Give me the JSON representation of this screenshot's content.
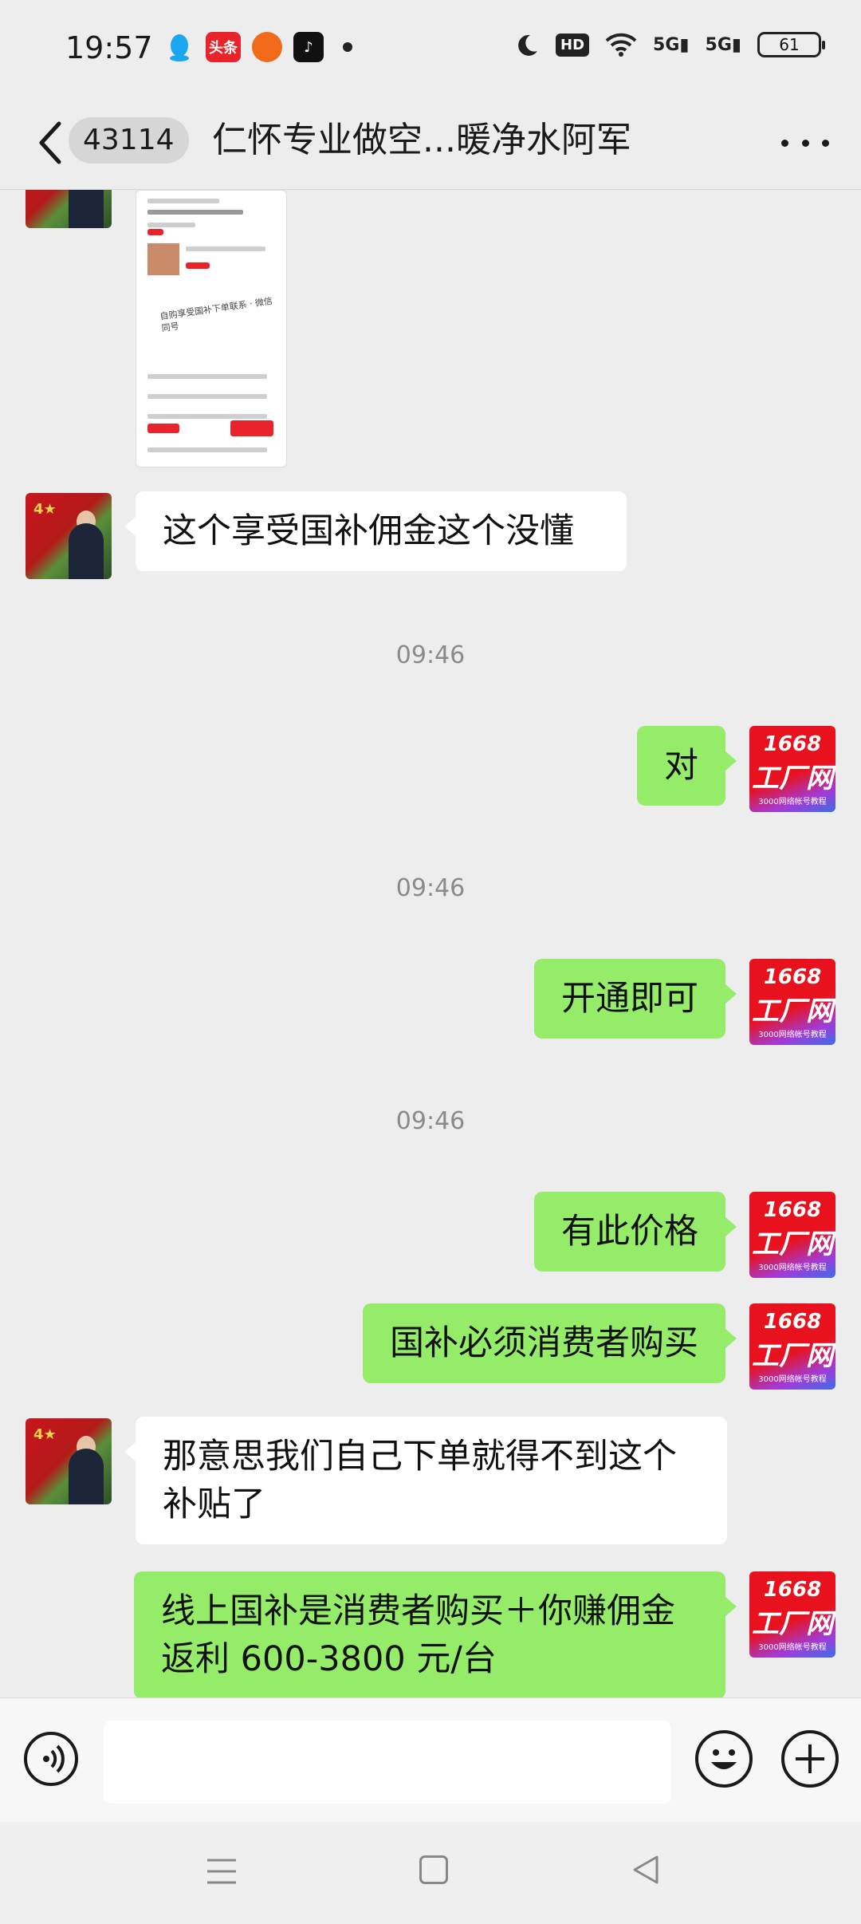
{
  "status_bar": {
    "time": "19:57",
    "app_icons": [
      "qq-icon",
      "toutiao-icon",
      "shop-icon",
      "tiktok-icon"
    ],
    "toutiao_label": "头条",
    "hd_label": "HD",
    "signal1": "5G",
    "signal2": "5G",
    "battery": "61"
  },
  "header": {
    "unread_count": "43114",
    "title": "仁怀专业做空...暖净水阿军"
  },
  "messages": [
    {
      "side": "in",
      "type": "image"
    },
    {
      "side": "in",
      "type": "text",
      "text": "这个享受国补佣金这个没懂"
    },
    {
      "type": "time",
      "text": "09:46"
    },
    {
      "side": "out",
      "type": "text",
      "text": "对"
    },
    {
      "type": "time",
      "text": "09:46"
    },
    {
      "side": "out",
      "type": "text",
      "text": "开通即可"
    },
    {
      "type": "time",
      "text": "09:46"
    },
    {
      "side": "out",
      "type": "text",
      "text": "有此价格"
    },
    {
      "side": "out",
      "type": "text",
      "text": "国补必须消费者购买"
    },
    {
      "side": "in",
      "type": "text",
      "text": "那意思我们自己下单就得不到这个补贴了"
    },
    {
      "side": "out",
      "type": "text",
      "text": "线上国补是消费者购买＋你赚佣金返利 600-3800 元/台"
    }
  ],
  "avatar_right": {
    "line1": "1668",
    "line2": "工厂网",
    "line3": "3000网络帐号教程"
  },
  "colors": {
    "bg": "#ededed",
    "out_bubble": "#95ec69",
    "in_bubble": "#ffffff"
  }
}
